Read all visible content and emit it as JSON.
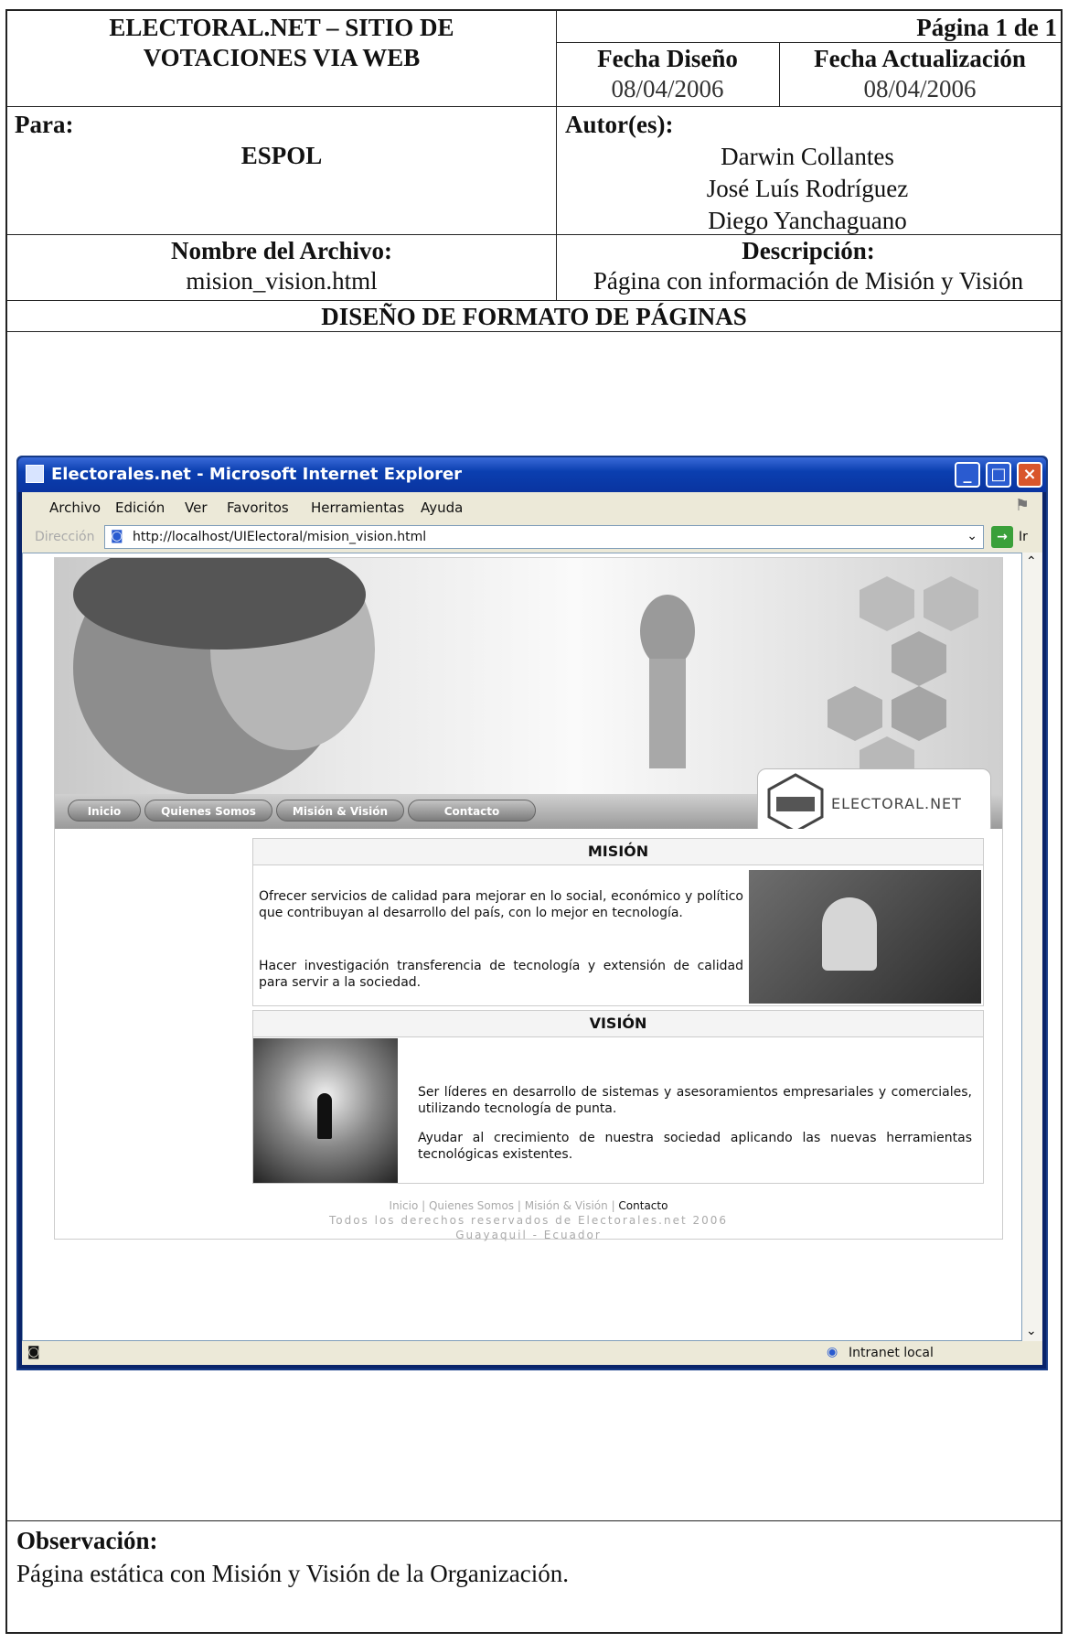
{
  "header": {
    "title_line1": "ELECTORAL.NET – SITIO DE",
    "title_line2": "VOTACIONES VIA WEB",
    "page_label": "Página 1 de 1",
    "fecha_diseno_label": "Fecha Diseño",
    "fecha_diseno": "08/04/2006",
    "fecha_actualizacion_label": "Fecha Actualización",
    "fecha_actualizacion": "08/04/2006",
    "para_label": "Para:",
    "para": "ESPOL",
    "autores_label": "Autor(es):",
    "autores": [
      "Darwin Collantes",
      "José Luís Rodríguez",
      "Diego Yanchaguano"
    ],
    "archivo_label": "Nombre del Archivo:",
    "archivo": "mision_vision.html",
    "descripcion_label": "Descripción:",
    "descripcion": "Página con información de Misión y Visión",
    "section_title": "DISEÑO DE FORMATO DE PÁGINAS"
  },
  "browser": {
    "title": "Electorales.net - Microsoft Internet Explorer",
    "menu": [
      "Archivo",
      "Edición",
      "Ver",
      "Favoritos",
      "Herramientas",
      "Ayuda"
    ],
    "address_label": "Dirección",
    "url": "http://localhost/UIElectoral/mision_vision.html",
    "go_label": "Ir",
    "status_zone": "Intranet local"
  },
  "site": {
    "nav": [
      "Inicio",
      "Quienes Somos",
      "Misión & Visión",
      "Contacto"
    ],
    "logo_text": "ELECTORAL.NET",
    "mision_title": "MISIÓN",
    "mision_p1": "Ofrecer servicios de calidad para mejorar en lo social, económico y político que contribuyan al desarrollo del país, con lo mejor en tecnología.",
    "mision_p2": "Hacer investigación transferencia de tecnología y extensión de calidad para servir a la sociedad.",
    "vision_title": "VISIÓN",
    "vision_p1": "Ser líderes en desarrollo de sistemas y asesoramientos empresariales y comerciales, utilizando tecnología de punta.",
    "vision_p2": "Ayudar al crecimiento de nuestra sociedad aplicando las nuevas herramientas tecnológicas existentes.",
    "footer_links": [
      "Inicio",
      "Quienes Somos",
      "Misión & Visión",
      "Contacto"
    ],
    "footer_copy": "Todos los derechos reservados de Electorales.net 2006",
    "footer_loc": "Guayaquil - Ecuador"
  },
  "observacion": {
    "label": "Observación:",
    "text": "Página estática con Misión y Visión de la Organización."
  }
}
